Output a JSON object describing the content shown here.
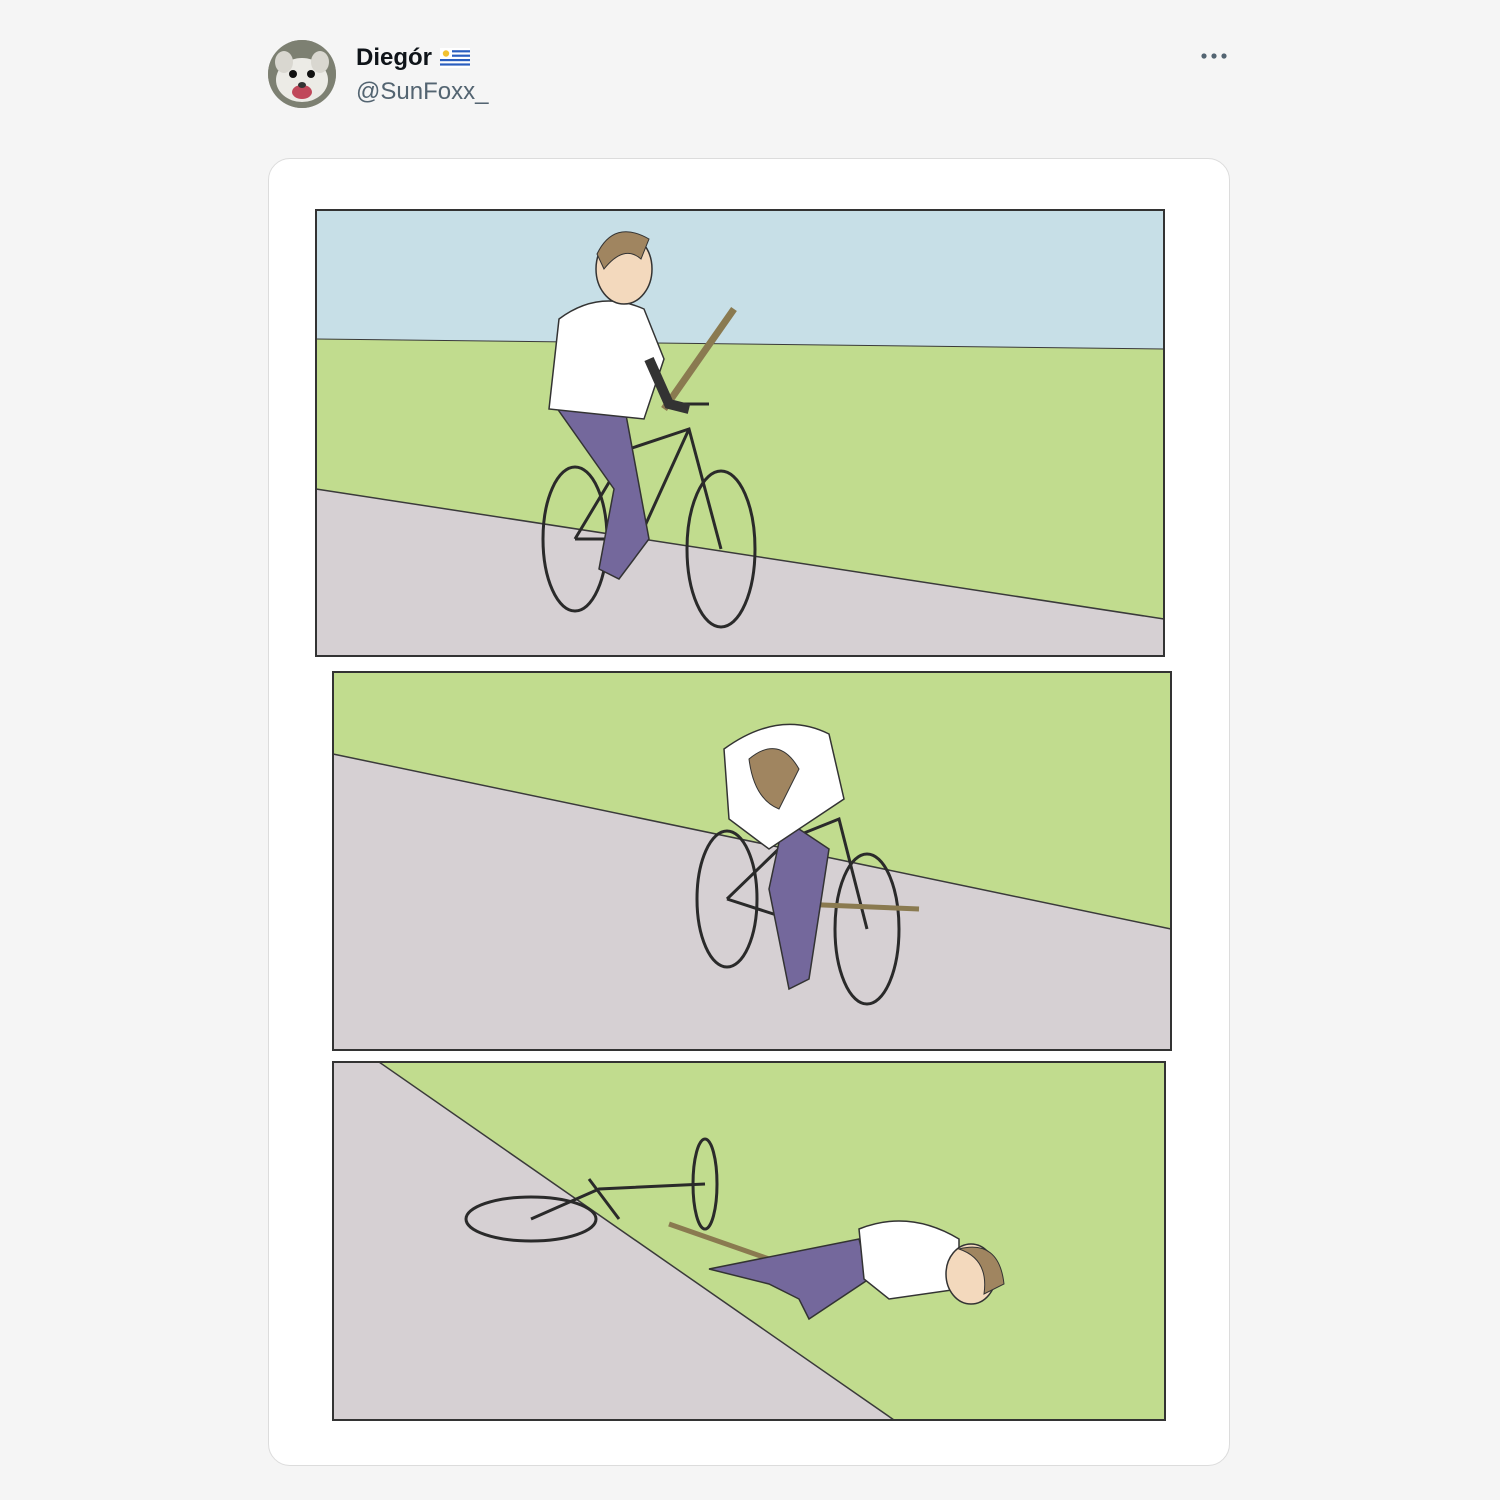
{
  "author": {
    "display_name": "Diegór",
    "handle": "@SunFoxx_",
    "avatar_icon": "opossum-avatar-icon",
    "flag_icon": "uruguay-flag-icon"
  },
  "menu": {
    "more_icon": "more-dots-icon"
  },
  "media": {
    "type": "image",
    "description_icon": "bike-stick-comic"
  },
  "colors": {
    "sky": "#c7dfe7",
    "grass": "#c1dc8e",
    "road": "#d6d0d3",
    "pants": "#74689c",
    "shirt": "#ffffff",
    "hair": "#a08560",
    "skin": "#f3d9bd",
    "background": "#f5f5f5",
    "name": "#0f1419",
    "handle": "#536471"
  }
}
